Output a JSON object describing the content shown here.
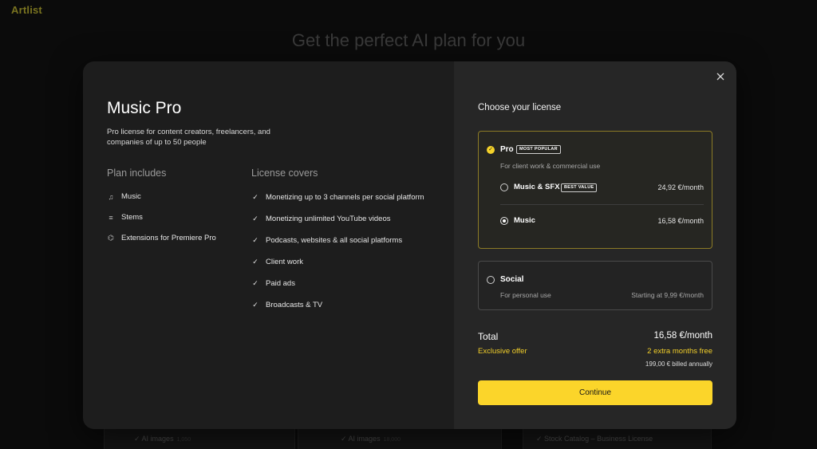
{
  "background": {
    "logo_text": "Artlist",
    "heading": "Get the perfect AI plan for you",
    "cards": [
      {
        "text": "AI images",
        "meta": "1,050"
      },
      {
        "text": "AI images",
        "meta": "18,000"
      },
      {
        "text": "Stock Catalog – Business License",
        "meta": ""
      }
    ]
  },
  "plan": {
    "title": "Music Pro",
    "description": "Pro license for content creators, freelancers, and companies of up to 50 people",
    "includes_heading": "Plan includes",
    "includes": [
      {
        "icon": "music-note-icon",
        "glyph": "♫",
        "label": "Music"
      },
      {
        "icon": "stems-icon",
        "glyph": "≡",
        "label": "Stems"
      },
      {
        "icon": "extension-icon",
        "glyph": "⌬",
        "label": "Extensions for Premiere Pro"
      }
    ],
    "covers_heading": "License covers",
    "covers": [
      "Monetizing up to 3 channels per social platform",
      "Monetizing unlimited YouTube videos",
      "Podcasts, websites & all social platforms",
      "Client work",
      "Paid ads",
      "Broadcasts & TV"
    ]
  },
  "license": {
    "title": "Choose your license",
    "pro": {
      "label": "Pro",
      "badge": "MOST POPULAR",
      "subtitle": "For client work & commercial use",
      "options": [
        {
          "label": "Music & SFX",
          "badge": "BEST VALUE",
          "price": "24,92 €/month",
          "selected": false
        },
        {
          "label": "Music",
          "badge": "",
          "price": "16,58 €/month",
          "selected": true
        }
      ]
    },
    "social": {
      "label": "Social",
      "subtitle": "For personal use",
      "price": "Starting at 9,99 €/month"
    }
  },
  "summary": {
    "total_label": "Total",
    "total_value": "16,58 €/month",
    "offer_label": "Exclusive offer",
    "offer_value": "2 extra months free",
    "billed": "199,00 € billed annually"
  },
  "continue_label": "Continue",
  "colors": {
    "accent": "#fbd52a",
    "offer": "#f2cf2a",
    "left_pane": "#1d1d1d",
    "right_pane": "#262626"
  }
}
